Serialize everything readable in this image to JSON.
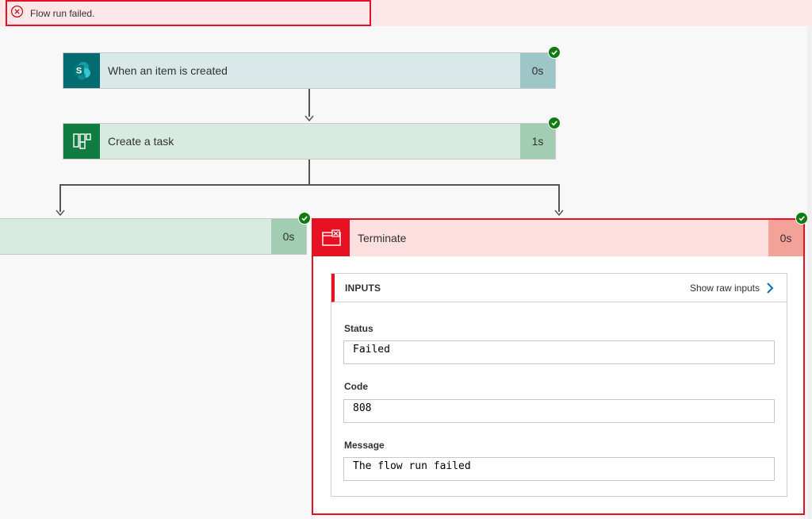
{
  "status": {
    "message": "Flow run failed.",
    "icon": "error-circle-icon"
  },
  "steps": [
    {
      "title": "When an item is created",
      "duration": "0s",
      "icon": "sharepoint-icon",
      "accent": "#036c70"
    },
    {
      "title": "Create a task",
      "duration": "1s",
      "icon": "planner-icon",
      "accent": "#107c41"
    },
    {
      "title": "",
      "duration": "0s"
    }
  ],
  "terminate": {
    "title": "Terminate",
    "duration": "0s",
    "icon": "terminate-icon",
    "inputs": {
      "heading": "INPUTS",
      "show_raw": "Show raw inputs",
      "fields": [
        {
          "label": "Status",
          "value": "Failed"
        },
        {
          "label": "Code",
          "value": "808"
        },
        {
          "label": "Message",
          "value": "The flow run failed"
        }
      ]
    }
  },
  "colors": {
    "error": "#e81123",
    "success": "#107c10",
    "error_bg": "#fde7e9"
  }
}
